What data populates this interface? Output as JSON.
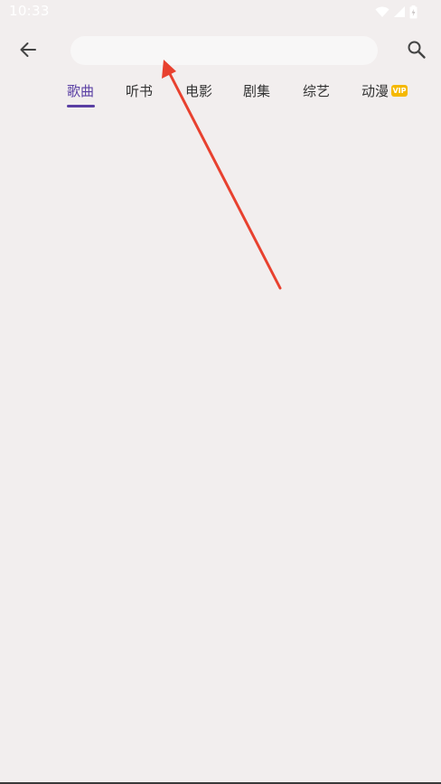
{
  "status_bar": {
    "time": "10:33",
    "icons": [
      "wifi-icon",
      "signal-icon",
      "battery-icon"
    ]
  },
  "header": {
    "back_icon": "arrow-left-icon",
    "search_placeholder": "",
    "search_value": "",
    "search_icon": "search-icon"
  },
  "tabs": [
    {
      "label": "歌曲",
      "active": true
    },
    {
      "label": "听书",
      "active": false
    },
    {
      "label": "电影",
      "active": false
    },
    {
      "label": "剧集",
      "active": false
    },
    {
      "label": "综艺",
      "active": false
    },
    {
      "label": "动漫",
      "active": false,
      "badge": "VIP"
    }
  ],
  "colors": {
    "background": "#f2eeee",
    "accent": "#5a3fa3",
    "vip_badge": "#f5b800",
    "annotation_arrow": "#e8412f"
  }
}
